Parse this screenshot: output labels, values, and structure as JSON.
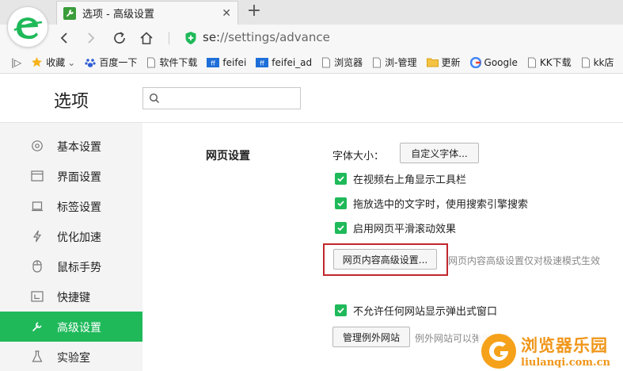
{
  "browser": {
    "tab_title": "选项 - 高级设置",
    "close_glyph": "✕",
    "new_tab_glyph": "+",
    "address": {
      "scheme": "se:",
      "rest": "//settings/advance"
    }
  },
  "bookmarks": {
    "sidebar_toggle": "|▷",
    "items": [
      {
        "label": "收藏",
        "icon": "star-icon",
        "suffix": "⌄"
      },
      {
        "label": "百度一下",
        "icon": "baidu-paw-icon"
      },
      {
        "label": "软件下载",
        "icon": "page-icon"
      },
      {
        "label": "feifei",
        "icon": "blue-site-icon"
      },
      {
        "label": "feifei_ad",
        "icon": "blue-site-icon"
      },
      {
        "label": "浏览器",
        "icon": "page-icon"
      },
      {
        "label": "浏-管理",
        "icon": "page-icon"
      },
      {
        "label": "更新",
        "icon": "folder-icon"
      },
      {
        "label": "Google",
        "icon": "google-icon"
      },
      {
        "label": "KK下载",
        "icon": "page-icon"
      },
      {
        "label": "kk店",
        "icon": "page-icon"
      }
    ]
  },
  "page": {
    "title": "选项",
    "search_placeholder": ""
  },
  "sidebar": {
    "items": [
      {
        "label": "基本设置",
        "icon": "gear-icon",
        "active": false
      },
      {
        "label": "界面设置",
        "icon": "window-icon",
        "active": false
      },
      {
        "label": "标签设置",
        "icon": "tab-icon",
        "active": false
      },
      {
        "label": "优化加速",
        "icon": "lightning-icon",
        "active": false
      },
      {
        "label": "鼠标手势",
        "icon": "mouse-icon",
        "active": false
      },
      {
        "label": "快捷键",
        "icon": "shortcut-icon",
        "active": false
      },
      {
        "label": "高级设置",
        "icon": "wrench-icon",
        "active": true
      },
      {
        "label": "实验室",
        "icon": "flask-icon",
        "active": false
      }
    ]
  },
  "content": {
    "section_title": "网页设置",
    "font_size_label": "字体大小：",
    "custom_font_button": "自定义字体...",
    "checkboxes": [
      {
        "label": "在视频右上角显示工具栏",
        "checked": true
      },
      {
        "label": "拖放选中的文字时，使用搜索引擎搜索",
        "checked": true
      },
      {
        "label": "启用网页平滑滚动效果",
        "checked": true
      }
    ],
    "advanced_button": "网页内容高级设置...",
    "advanced_hint": "网页内容高级设置仅对极速模式生效",
    "popup_checkbox": {
      "label": "不允许任何网站显示弹出式窗口",
      "checked": true
    },
    "exceptions_button": "管理例外网站",
    "exceptions_hint": "例外网站可以弹出窗口"
  },
  "watermark": {
    "name": "浏览器乐园",
    "url": "liulanqi.com.cn"
  },
  "colors": {
    "accent": "#1fb95a",
    "highlight": "#c0272d",
    "watermark": "#f0961a"
  }
}
